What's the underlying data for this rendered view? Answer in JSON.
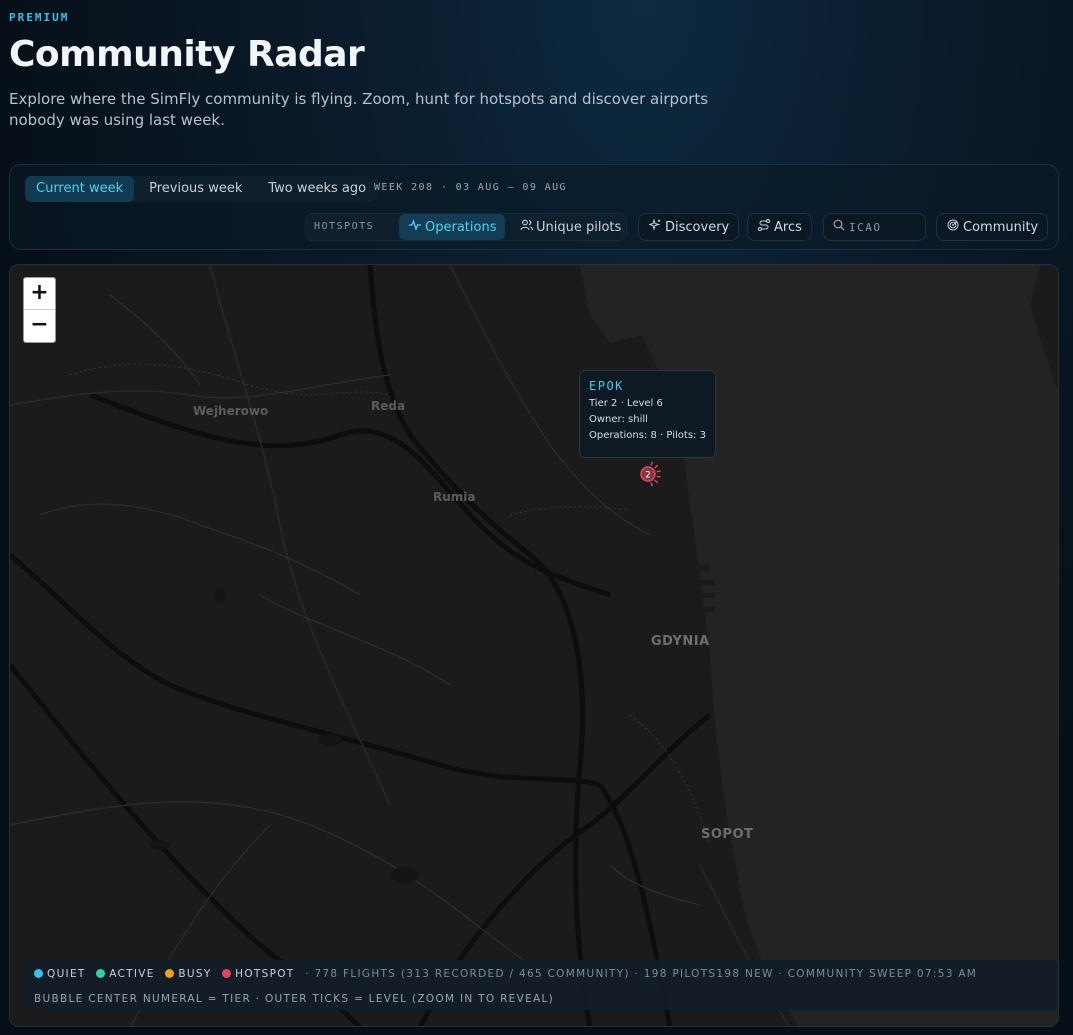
{
  "header": {
    "eyebrow": "PREMIUM",
    "title": "Community Radar",
    "subtitle": "Explore where the SimFly community is flying. Zoom, hunt for hotspots and discover airports nobody was using last week."
  },
  "week_tabs": [
    {
      "label": "Current week",
      "active": true
    },
    {
      "label": "Previous week",
      "active": false
    },
    {
      "label": "Two weeks ago",
      "active": false
    }
  ],
  "week_label": "WEEK 208 · 03 AUG – 09 AUG",
  "hotspots": {
    "label": "HOTSPOTS",
    "options": [
      {
        "label": "Operations",
        "icon": "activity-icon",
        "active": true
      },
      {
        "label": "Unique pilots",
        "icon": "users-icon",
        "active": false
      }
    ]
  },
  "buttons": {
    "discovery": "Discovery",
    "arcs": "Arcs",
    "community": "Community"
  },
  "search": {
    "placeholder": "ICAO",
    "value": ""
  },
  "map": {
    "zoom_in": "+",
    "zoom_out": "−",
    "places": {
      "wejherowo": "Wejherowo",
      "reda": "Reda",
      "rumia": "Rumia",
      "gdynia": "GDYNIA",
      "sopot": "SOPOT"
    },
    "tooltip": {
      "code": "EPOK",
      "tier_level": "Tier 2 · Level 6",
      "owner": "Owner: shill",
      "stats": "Operations: 8 · Pilots: 3"
    },
    "marker": {
      "tier": "2",
      "level": 6,
      "color": "#e0485f"
    }
  },
  "legend": {
    "items": [
      {
        "label": "QUIET",
        "color": "#38c1e6"
      },
      {
        "label": "ACTIVE",
        "color": "#34d39e"
      },
      {
        "label": "BUSY",
        "color": "#f0a020"
      },
      {
        "label": "HOTSPOT",
        "color": "#e8435d"
      }
    ],
    "stats": "· 778 FLIGHTS (313 RECORDED / 465 COMMUNITY) · 198 PILOTS198 NEW · COMMUNITY SWEEP 07:53 AM",
    "note": "BUBBLE CENTER NUMERAL = TIER · OUTER TICKS = LEVEL (ZOOM IN TO REVEAL)"
  }
}
